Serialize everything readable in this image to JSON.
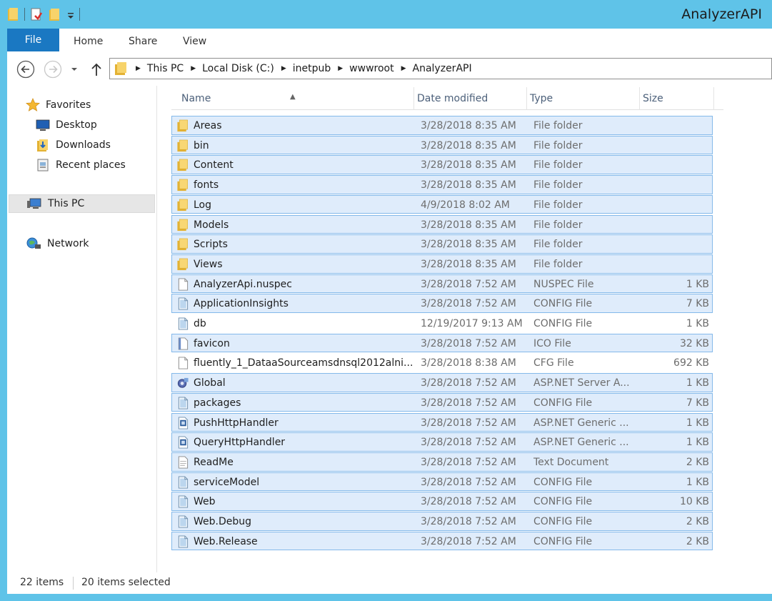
{
  "window": {
    "title": "AnalyzerAPI"
  },
  "ribbon": {
    "tabs": [
      "File",
      "Home",
      "Share",
      "View"
    ]
  },
  "address": {
    "crumbs": [
      "This PC",
      "Local Disk (C:)",
      "inetpub",
      "wwwroot",
      "AnalyzerAPI"
    ]
  },
  "nav": {
    "favorites": "Favorites",
    "desktop": "Desktop",
    "downloads": "Downloads",
    "recent": "Recent places",
    "thispc": "This PC",
    "network": "Network"
  },
  "columns": {
    "name": "Name",
    "date": "Date modified",
    "type": "Type",
    "size": "Size"
  },
  "files": [
    {
      "name": "Areas",
      "date": "3/28/2018 8:35 AM",
      "type": "File folder",
      "size": "",
      "icon": "folder-icon",
      "selected": true
    },
    {
      "name": "bin",
      "date": "3/28/2018 8:35 AM",
      "type": "File folder",
      "size": "",
      "icon": "folder-icon",
      "selected": true
    },
    {
      "name": "Content",
      "date": "3/28/2018 8:35 AM",
      "type": "File folder",
      "size": "",
      "icon": "folder-icon",
      "selected": true
    },
    {
      "name": "fonts",
      "date": "3/28/2018 8:35 AM",
      "type": "File folder",
      "size": "",
      "icon": "folder-icon",
      "selected": true
    },
    {
      "name": "Log",
      "date": "4/9/2018 8:02 AM",
      "type": "File folder",
      "size": "",
      "icon": "folder-icon",
      "selected": true
    },
    {
      "name": "Models",
      "date": "3/28/2018 8:35 AM",
      "type": "File folder",
      "size": "",
      "icon": "folder-icon",
      "selected": true
    },
    {
      "name": "Scripts",
      "date": "3/28/2018 8:35 AM",
      "type": "File folder",
      "size": "",
      "icon": "folder-icon",
      "selected": true
    },
    {
      "name": "Views",
      "date": "3/28/2018 8:35 AM",
      "type": "File folder",
      "size": "",
      "icon": "folder-icon",
      "selected": true
    },
    {
      "name": "AnalyzerApi.nuspec",
      "date": "3/28/2018 7:52 AM",
      "type": "NUSPEC File",
      "size": "1 KB",
      "icon": "blank-file-icon",
      "selected": true
    },
    {
      "name": "ApplicationInsights",
      "date": "3/28/2018 7:52 AM",
      "type": "CONFIG File",
      "size": "7 KB",
      "icon": "config-file-icon",
      "selected": true
    },
    {
      "name": "db",
      "date": "12/19/2017 9:13 AM",
      "type": "CONFIG File",
      "size": "1 KB",
      "icon": "config-file-icon",
      "selected": false
    },
    {
      "name": "favicon",
      "date": "3/28/2018 7:52 AM",
      "type": "ICO File",
      "size": "32 KB",
      "icon": "ico-file-icon",
      "selected": true
    },
    {
      "name": "fluently_1_DataaSourceamsdnsql2012alni...",
      "date": "3/28/2018 8:38 AM",
      "type": "CFG File",
      "size": "692 KB",
      "icon": "blank-file-icon",
      "selected": false
    },
    {
      "name": "Global",
      "date": "3/28/2018 7:52 AM",
      "type": "ASP.NET Server A...",
      "size": "1 KB",
      "icon": "aspnet-server-icon",
      "selected": true
    },
    {
      "name": "packages",
      "date": "3/28/2018 7:52 AM",
      "type": "CONFIG File",
      "size": "7 KB",
      "icon": "config-file-icon",
      "selected": true
    },
    {
      "name": "PushHttpHandler",
      "date": "3/28/2018 7:52 AM",
      "type": "ASP.NET Generic ...",
      "size": "1 KB",
      "icon": "aspnet-handler-icon",
      "selected": true
    },
    {
      "name": "QueryHttpHandler",
      "date": "3/28/2018 7:52 AM",
      "type": "ASP.NET Generic ...",
      "size": "1 KB",
      "icon": "aspnet-handler-icon",
      "selected": true
    },
    {
      "name": "ReadMe",
      "date": "3/28/2018 7:52 AM",
      "type": "Text Document",
      "size": "2 KB",
      "icon": "text-file-icon",
      "selected": true
    },
    {
      "name": "serviceModel",
      "date": "3/28/2018 7:52 AM",
      "type": "CONFIG File",
      "size": "1 KB",
      "icon": "config-file-icon",
      "selected": true
    },
    {
      "name": "Web",
      "date": "3/28/2018 7:52 AM",
      "type": "CONFIG File",
      "size": "10 KB",
      "icon": "config-file-icon",
      "selected": true
    },
    {
      "name": "Web.Debug",
      "date": "3/28/2018 7:52 AM",
      "type": "CONFIG File",
      "size": "2 KB",
      "icon": "config-file-icon",
      "selected": true
    },
    {
      "name": "Web.Release",
      "date": "3/28/2018 7:52 AM",
      "type": "CONFIG File",
      "size": "2 KB",
      "icon": "config-file-icon",
      "selected": true
    }
  ],
  "status": {
    "count": "22 items",
    "selected": "20 items selected"
  },
  "colors": {
    "frame": "#5fc3e8",
    "fileTab": "#1a78c2",
    "selection": "#dfecfb",
    "selectionBorder": "#84b9ea"
  }
}
